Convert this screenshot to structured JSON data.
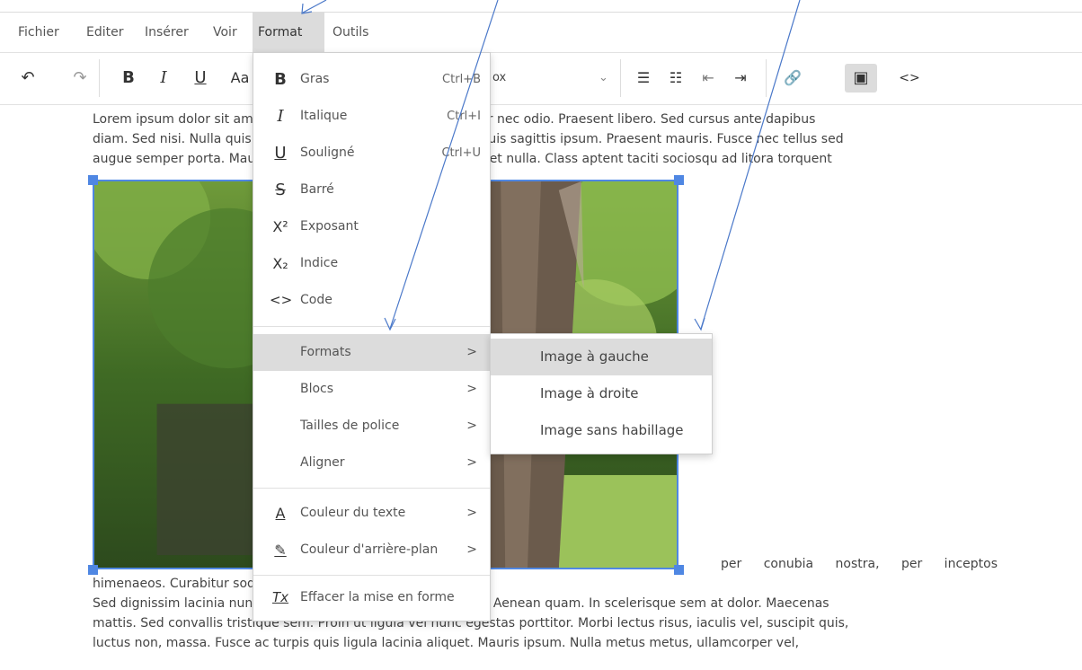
{
  "menubar": {
    "items": [
      {
        "label": "Fichier"
      },
      {
        "label": "Editer"
      },
      {
        "label": "Insérer"
      },
      {
        "label": "Voir"
      },
      {
        "label": "Format"
      },
      {
        "label": "Outils"
      }
    ]
  },
  "toolbar": {
    "undo_icon": "↶",
    "redo_icon": "↷",
    "bold": "B",
    "italic": "I",
    "underline": "U",
    "case": "Aa",
    "select_value": "ox",
    "select_arrow": "⌄",
    "bullet_icon": "☰",
    "numlist_icon": "☷",
    "outdent_icon": "⇤",
    "indent_icon": "⇥",
    "link_icon": "🔗",
    "image_icon": "▣",
    "code_icon": "<>"
  },
  "document": {
    "p1_lines": [
      "Lorem ipsum dolor sit amet, consectetur adipiscing elit. Integer nec odio. Praesent libero. Sed cursus ante dapibus",
      "diam. Sed nisi. Nulla quis sem at nibh elementum imperdiet. Duis sagittis ipsum. Praesent mauris. Fusce nec tellus sed",
      "augue semper porta. Mauris massa. Vestibulum lacinia arcu eget nulla. Class aptent taciti sociosqu ad litora torquent"
    ],
    "p2_lines": [
      "per conubia nostra, per inceptos",
      "himenaeos. Curabitur sodales ligula in libero."
    ],
    "p3_lines": [
      "Sed dignissim lacinia nunc. Curabitur tortor. Pellentesque nibh. Aenean quam. In scelerisque sem at dolor. Maecenas",
      "mattis. Sed convallis tristique sem. Proin ut ligula vel nunc egestas porttitor. Morbi lectus risus, iaculis vel, suscipit quis,",
      "luctus non, massa. Fusce ac turpis quis ligula lacinia aliquet. Mauris ipsum. Nulla metus metus, ullamcorper vel,"
    ]
  },
  "format_menu": {
    "items": [
      {
        "icon": "B",
        "label": "Gras",
        "shortcut": "Ctrl+B"
      },
      {
        "icon": "I",
        "label": "Italique",
        "shortcut": "Ctrl+I"
      },
      {
        "icon": "U",
        "label": "Souligné",
        "shortcut": "Ctrl+U"
      },
      {
        "icon": "S",
        "label": "Barré"
      },
      {
        "icon": "X²",
        "label": "Exposant"
      },
      {
        "icon": "X₂",
        "label": "Indice"
      },
      {
        "icon": "<>",
        "label": "Code"
      },
      {
        "label": "Formats",
        "arrow": ">"
      },
      {
        "label": "Blocs",
        "arrow": ">"
      },
      {
        "label": "Tailles de police",
        "arrow": ">"
      },
      {
        "label": "Aligner",
        "arrow": ">"
      },
      {
        "icon": "A",
        "label": "Couleur du texte",
        "arrow": ">"
      },
      {
        "icon": "✎",
        "label": "Couleur d'arrière-plan",
        "arrow": ">"
      },
      {
        "icon": "Tx",
        "label": "Effacer la mise en forme"
      }
    ]
  },
  "formats_submenu": {
    "items": [
      {
        "label": "Image à gauche"
      },
      {
        "label": "Image à droite"
      },
      {
        "label": "Image sans habillage"
      }
    ]
  },
  "colors": {
    "selection": "#4f87e3",
    "arrow": "#4a78c9",
    "highlight": "#dcdcdc"
  }
}
